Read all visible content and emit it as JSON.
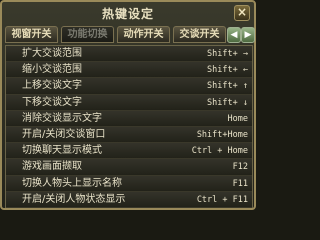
{
  "window": {
    "title": "热键设定",
    "close": "×"
  },
  "tabs": [
    {
      "label": "视窗开关",
      "active": false
    },
    {
      "label": "功能切换",
      "active": true
    },
    {
      "label": "动作开关",
      "active": false
    },
    {
      "label": "交谈开关",
      "active": false
    }
  ],
  "tab_nav": {
    "prev": "◀",
    "next": "▶"
  },
  "hotkeys": [
    {
      "label": "扩大交谈范围",
      "key": "Shift+ →"
    },
    {
      "label": "缩小交谈范围",
      "key": "Shift+ ←"
    },
    {
      "label": "上移交谈文字",
      "key": "Shift+ ↑"
    },
    {
      "label": "下移交谈文字",
      "key": "Shift+ ↓"
    },
    {
      "label": "消除交谈显示文字",
      "key": "Home"
    },
    {
      "label": "开启/关闭交谈窗口",
      "key": "Shift+Home"
    },
    {
      "label": "切换聊天显示模式",
      "key": "Ctrl + Home"
    },
    {
      "label": "游戏画面撷取",
      "key": "F12"
    },
    {
      "label": "切换人物头上显示名称",
      "key": "F11"
    },
    {
      "label": "开启/关闭人物状态显示",
      "key": "Ctrl + F11"
    }
  ]
}
